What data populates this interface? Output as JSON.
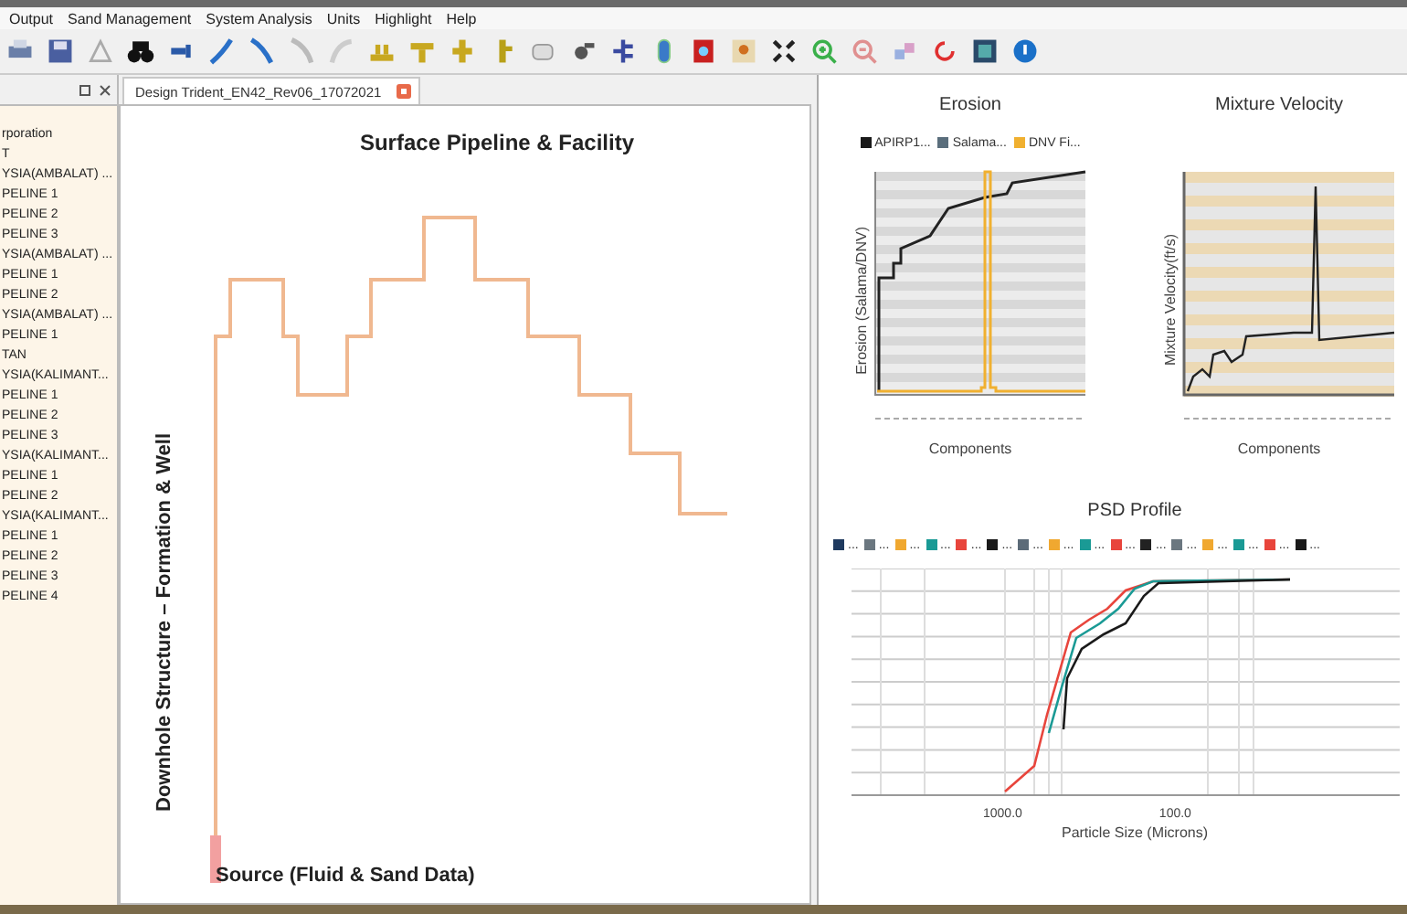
{
  "menu": [
    {
      "label": "Output"
    },
    {
      "label": "Sand Management"
    },
    {
      "label": "System Analysis"
    },
    {
      "label": "Units"
    },
    {
      "label": "Highlight"
    },
    {
      "label": "Help"
    }
  ],
  "sidebar": {
    "items": [
      "rporation",
      "T",
      "YSIA(AMBALAT) ...",
      "PELINE 1",
      "PELINE 2",
      "PELINE 3",
      "YSIA(AMBALAT) ...",
      "PELINE 1",
      "PELINE 2",
      "YSIA(AMBALAT) ...",
      "PELINE 1",
      "TAN",
      "YSIA(KALIMANT...",
      "PELINE 1",
      "PELINE 2",
      "PELINE 3",
      "YSIA(KALIMANT...",
      "PELINE 1",
      "PELINE 2",
      "YSIA(KALIMANT...",
      "PELINE 1",
      "PELINE 2",
      "PELINE 3",
      "PELINE 4"
    ]
  },
  "document_tab": {
    "label": "Design Trident_EN42_Rev06_17072021",
    "selected": true
  },
  "diagram": {
    "title": "Surface Pipeline & Facility",
    "side_label": "Downhole Structure – Formation & Well",
    "source_label": "Source (Fluid & Sand Data)"
  },
  "charts": [
    {
      "kind": "erosion",
      "title": "Erosion",
      "ylabel": "Erosion (Salama/DNV)",
      "xlabel": "Components",
      "legend": [
        {
          "label": "APIRP1...",
          "color": "#1a1a1a"
        },
        {
          "label": "Salama...",
          "color": "#5a6e7c"
        },
        {
          "label": "DNV Fi...",
          "color": "#f0b030"
        }
      ]
    },
    {
      "kind": "velocity",
      "title": "Mixture Velocity",
      "ylabel": "Mixture Velocity(ft/s)",
      "xlabel": "Components"
    }
  ],
  "psd": {
    "title": "PSD Profile",
    "xlabel": "Particle Size (Microns)",
    "xticks": [
      "1000.0",
      "100.0"
    ],
    "legend": [
      {
        "label": "...",
        "color": "#1f3a5f"
      },
      {
        "label": "...",
        "color": "#6b7780"
      },
      {
        "label": "...",
        "color": "#f0a830"
      },
      {
        "label": "...",
        "color": "#1a9a95"
      },
      {
        "label": "...",
        "color": "#e8453c"
      },
      {
        "label": "...",
        "color": "#1a1a1a"
      },
      {
        "label": "...",
        "color": "#5c6b78"
      },
      {
        "label": "...",
        "color": "#f0a830"
      },
      {
        "label": "...",
        "color": "#1a9a95"
      },
      {
        "label": "...",
        "color": "#e8453c"
      },
      {
        "label": "...",
        "color": "#222222"
      },
      {
        "label": "...",
        "color": "#6b7780"
      },
      {
        "label": "...",
        "color": "#f0a830"
      },
      {
        "label": "...",
        "color": "#1a9a95"
      },
      {
        "label": "...",
        "color": "#e8453c"
      },
      {
        "label": "...",
        "color": "#1a1a1a"
      }
    ]
  }
}
